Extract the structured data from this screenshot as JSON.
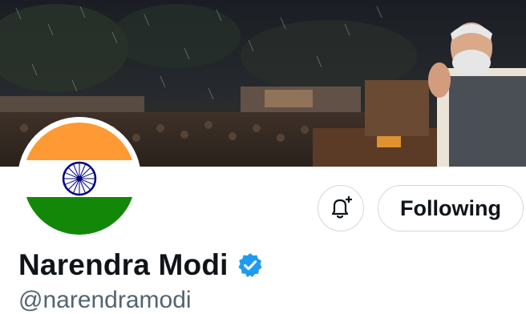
{
  "profile": {
    "display_name": "Narendra Modi",
    "handle": "@narendramodi",
    "verified": true,
    "verified_badge_color": "#1d9bf0"
  },
  "actions": {
    "notifications_icon": "bell-plus-icon",
    "follow_state_label": "Following"
  },
  "banner": {
    "description_icon": "banner-photo"
  },
  "avatar": {
    "image": "indian-flag",
    "colors": {
      "saffron": "#ff9933",
      "white": "#ffffff",
      "green": "#138808",
      "chakra": "#000080"
    }
  },
  "colors": {
    "text_primary": "#0f1419",
    "text_secondary": "#536471",
    "border": "#cfd9de"
  }
}
